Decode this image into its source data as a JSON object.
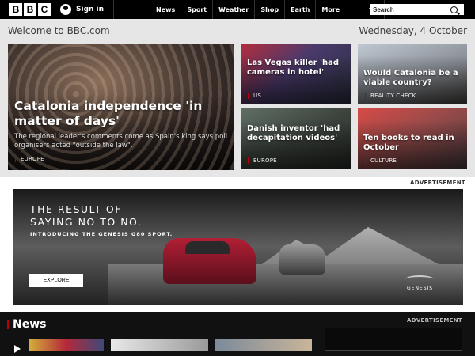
{
  "header": {
    "logo_letters": [
      "B",
      "B",
      "C"
    ],
    "signin_label": "Sign in",
    "nav": [
      "News",
      "Sport",
      "Weather",
      "Shop",
      "Earth",
      "More"
    ],
    "search_placeholder": "Search"
  },
  "welcome": "Welcome to BBC.com",
  "date": "Wednesday, 4 October",
  "stories": {
    "hero": {
      "headline": "Catalonia independence 'in matter of days'",
      "summary": "The regional leader's comments come as Spain's king says poll organisers acted \"outside the law\".",
      "tag": "EUROPE"
    },
    "s1": {
      "headline": "Las Vegas killer 'had cameras in hotel'",
      "tag": "US"
    },
    "s2": {
      "headline": "Would Catalonia be a viable country?",
      "tag": "REALITY CHECK"
    },
    "s3": {
      "headline": "Danish inventor 'had decapitation videos'",
      "tag": "EUROPE"
    },
    "s4": {
      "headline": "Ten books to read in October",
      "tag": "CULTURE"
    }
  },
  "advert": {
    "label": "ADVERTISEMENT",
    "headline_line1": "THE RESULT OF",
    "headline_line2": "SAYING NO TO NO.",
    "intro": "INTRODUCING THE GENESIS G80 SPORT.",
    "button": "EXPLORE",
    "brand": "GENESIS"
  },
  "news_section": {
    "title": "News",
    "ad_label": "ADVERTISEMENT"
  },
  "colors": {
    "accent": "#b80000",
    "topbar": "#000000",
    "page_bg": "#e6e6e6"
  },
  "icons": [
    "user-icon",
    "chevron-down-icon",
    "search-icon",
    "play-icon"
  ]
}
